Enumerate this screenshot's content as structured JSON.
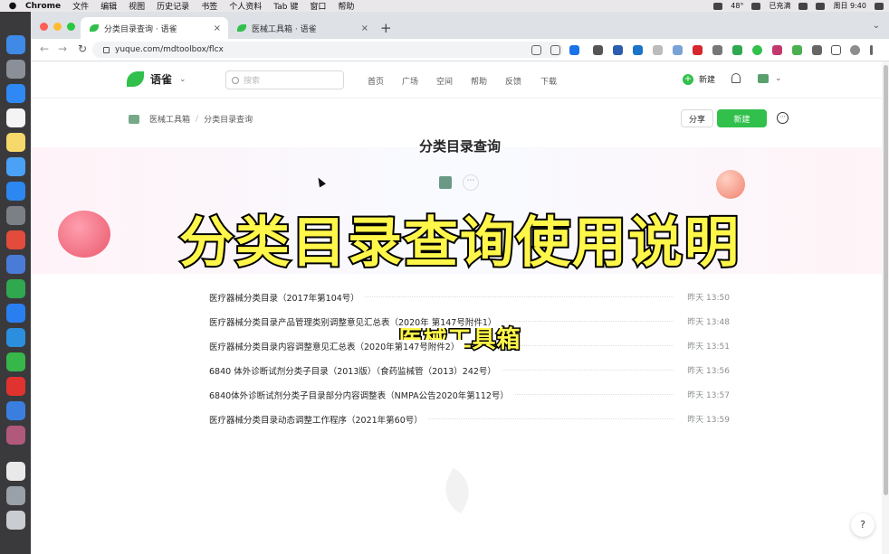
{
  "menubar": {
    "apple": "",
    "items": [
      "Chrome",
      "文件",
      "编辑",
      "视图",
      "历史记录",
      "书签",
      "个人资料",
      "Tab 键",
      "窗口",
      "帮助"
    ],
    "battery": "已充满",
    "temp": "48°",
    "clock": "周日 9:40"
  },
  "tabs": [
    {
      "title": "分类目录查询 · 语雀",
      "close": "×"
    },
    {
      "title": "医械工具箱 · 语雀",
      "close": "×"
    }
  ],
  "new_tab": "+",
  "tab_menu": "⌄",
  "nav": {
    "back": "←",
    "forward": "→",
    "reload": "↻"
  },
  "url": "yuque.com/mdtoolbox/flcx",
  "app": {
    "name": "语雀",
    "caret": "⌄",
    "search_placeholder": "搜索",
    "nav": [
      "首页",
      "广场",
      "空间",
      "帮助",
      "反馈",
      "下载"
    ],
    "new_label": "新建",
    "avatar_caret": "⌄"
  },
  "breadcrumb": {
    "book": "医械工具箱",
    "sep": "/",
    "page": "分类目录查询"
  },
  "actions": {
    "share": "分享",
    "new": "新建",
    "more": "⋯"
  },
  "doc_title": "分类目录查询",
  "book_more": "⋯",
  "overlay_title": "分类目录查询使用说明",
  "overlay_subtitle": "医械工具箱",
  "docs": [
    {
      "title": "医疗器械分类目录（2017年第104号）",
      "time": "昨天 13:50"
    },
    {
      "title": "医疗器械分类目录产品管理类别调整意见汇总表（2020年 第147号附件1）",
      "time": "昨天 13:48"
    },
    {
      "title": "医疗器械分类目录内容调整意见汇总表（2020年第147号附件2）",
      "time": "昨天 13:51"
    },
    {
      "title": "6840 体外诊断试剂分类子目录（2013版）（食药监械管（2013）242号）",
      "time": "昨天 13:56"
    },
    {
      "title": "6840体外诊断试剂分类子目录部分内容调整表（NMPA公告2020年第112号）",
      "time": "昨天 13:57"
    },
    {
      "title": "医疗器械分类目录动态调整工作程序（2021年第60号）",
      "time": "昨天 13:59"
    }
  ],
  "help": "?",
  "colors": {
    "brand": "#31c04b",
    "overlay_text": "#fff64a"
  }
}
